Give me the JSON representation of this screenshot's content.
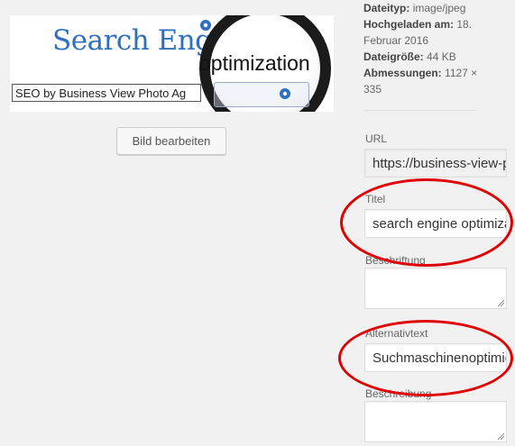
{
  "image_preview": {
    "headline": "Search Engine",
    "lens_text": "optimization",
    "caption_bar": "SEO by Business View Photo Ag"
  },
  "buttons": {
    "edit_image": "Bild bearbeiten"
  },
  "file_info": {
    "type_label": "Dateityp:",
    "type_value": "image/jpeg",
    "uploaded_label": "Hochgeladen am:",
    "uploaded_value_a": "18.",
    "uploaded_value_b": "Februar 2016",
    "size_label": "Dateigröße:",
    "size_value": "44 KB",
    "dims_label": "Abmessungen:",
    "dims_value_a": "1127 ×",
    "dims_value_b": "335"
  },
  "fields": {
    "url_label": "URL",
    "url_value": "https://business-view-photo.de/wp-content/uploads/search-engine-optimization.jpg",
    "title_label": "Titel",
    "title_value": "search engine optimization",
    "caption_label": "Beschriftung",
    "caption_value": "",
    "alt_label": "Alternativtext",
    "alt_value": "Suchmaschinenoptimierung",
    "description_label": "Beschreibung",
    "description_value": ""
  },
  "colors": {
    "highlight": "#e00000",
    "link_blue": "#2f6fc0"
  }
}
